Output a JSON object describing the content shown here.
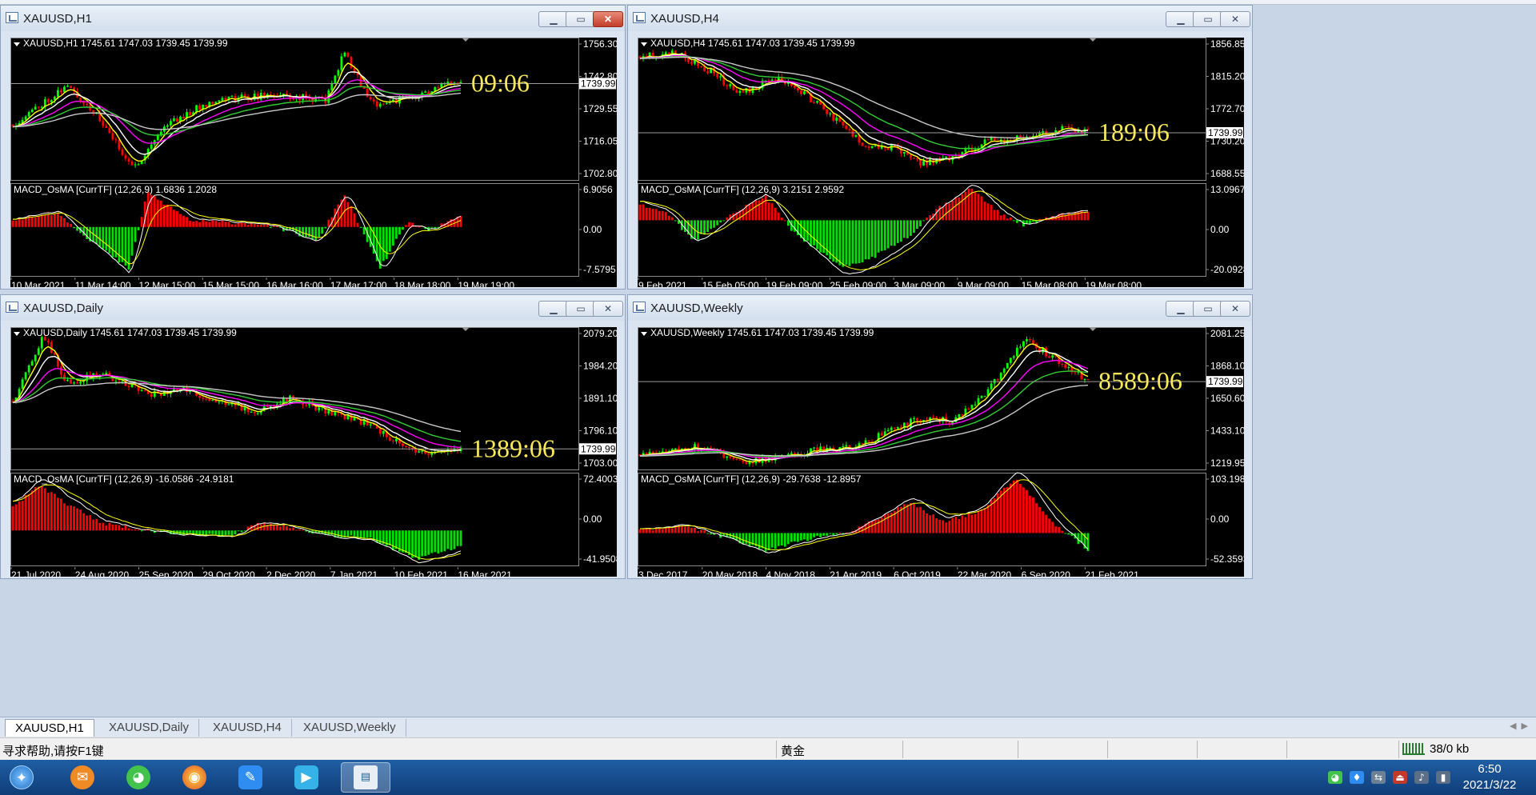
{
  "top_bar": {
    "label": ""
  },
  "windows": [
    {
      "id": "h1",
      "title": "XAUUSD,H1",
      "info": "XAUUSD,H1  1745.61 1747.03 1739.45 1739.99",
      "price_ticks": [
        "1756.30",
        "1742.80",
        "1729.55",
        "1716.05",
        "1702.80"
      ],
      "price_range": [
        1698.0,
        1760.0
      ],
      "current_price": "1739.99",
      "current_price_value": 1739.99,
      "countdown": "09:06",
      "macd_label": "MACD_OsMA [CurrTF] (12,26,9) 1.6836 1.2028",
      "macd_ticks": [
        "6.9056",
        "0.00",
        "-7.5795"
      ],
      "macd_range": [
        -8.5,
        7.6
      ],
      "time_ticks": [
        "10 Mar 2021",
        "11 Mar 14:00",
        "12 Mar 15:00",
        "15 Mar 15:00",
        "16 Mar 16:00",
        "17 Mar 17:00",
        "18 Mar 18:00",
        "19 Mar 19:00"
      ],
      "close_active": true,
      "seed": 11,
      "price_path": [
        [
          0,
          1722
        ],
        [
          0.12,
          1739
        ],
        [
          0.18,
          1728
        ],
        [
          0.27,
          1703
        ],
        [
          0.34,
          1722
        ],
        [
          0.45,
          1733
        ],
        [
          0.58,
          1735
        ],
        [
          0.7,
          1733
        ],
        [
          0.74,
          1754
        ],
        [
          0.8,
          1731
        ],
        [
          0.9,
          1734
        ],
        [
          1.0,
          1742
        ]
      ],
      "macd_path": [
        [
          0,
          1.2
        ],
        [
          0.1,
          2.5
        ],
        [
          0.16,
          -1.5
        ],
        [
          0.26,
          -7.3
        ],
        [
          0.3,
          6.0
        ],
        [
          0.4,
          1.0
        ],
        [
          0.55,
          0.6
        ],
        [
          0.62,
          -0.8
        ],
        [
          0.68,
          -2.5
        ],
        [
          0.74,
          5.8
        ],
        [
          0.82,
          -7.2
        ],
        [
          0.88,
          0.8
        ],
        [
          0.93,
          -0.5
        ],
        [
          1.0,
          1.7
        ]
      ]
    },
    {
      "id": "h4",
      "title": "XAUUSD,H4",
      "info": "XAUUSD,H4  1745.61 1747.03 1739.45 1739.99",
      "price_ticks": [
        "1856.85",
        "1815.20",
        "1772.70",
        "1730.20",
        "1688.55"
      ],
      "price_range": [
        1678.0,
        1865.0
      ],
      "current_price": "1739.99",
      "current_price_value": 1739.99,
      "countdown": "189:06",
      "macd_label": "MACD_OsMA [CurrTF] (12,26,9) 3.2151 2.9592",
      "macd_ticks": [
        "13.0967",
        "0.00",
        "-20.0928"
      ],
      "macd_range": [
        -21.0,
        14.0
      ],
      "time_ticks": [
        "9 Feb 2021",
        "15 Feb 05:00",
        "19 Feb 09:00",
        "25 Feb 09:00",
        "3 Mar 09:00",
        "9 Mar 09:00",
        "15 Mar 08:00",
        "19 Mar 08:00"
      ],
      "close_active": false,
      "seed": 23,
      "price_path": [
        [
          0,
          1840
        ],
        [
          0.08,
          1845
        ],
        [
          0.16,
          1820
        ],
        [
          0.22,
          1790
        ],
        [
          0.3,
          1812
        ],
        [
          0.36,
          1795
        ],
        [
          0.42,
          1765
        ],
        [
          0.5,
          1725
        ],
        [
          0.56,
          1720
        ],
        [
          0.63,
          1700
        ],
        [
          0.7,
          1708
        ],
        [
          0.78,
          1730
        ],
        [
          0.88,
          1735
        ],
        [
          0.94,
          1748
        ],
        [
          1.0,
          1742
        ]
      ],
      "macd_path": [
        [
          0,
          6
        ],
        [
          0.06,
          3
        ],
        [
          0.12,
          -8
        ],
        [
          0.2,
          2
        ],
        [
          0.28,
          9
        ],
        [
          0.34,
          -4
        ],
        [
          0.45,
          -18
        ],
        [
          0.52,
          -14
        ],
        [
          0.6,
          -6
        ],
        [
          0.66,
          4
        ],
        [
          0.74,
          12
        ],
        [
          0.8,
          3
        ],
        [
          0.86,
          -2
        ],
        [
          0.93,
          2
        ],
        [
          1.0,
          3
        ]
      ]
    },
    {
      "id": "daily",
      "title": "XAUUSD,Daily",
      "info": "XAUUSD,Daily  1745.61 1747.03 1739.45 1739.99",
      "price_ticks": [
        "2079.20",
        "1984.20",
        "1891.10",
        "1796.10",
        "1703.00"
      ],
      "price_range": [
        1680.0,
        2095.0
      ],
      "current_price": "1739.99",
      "current_price_value": 1739.99,
      "countdown": "1389:06",
      "macd_label": "MACD_OsMA [CurrTF] (12,26,9) -16.0586 -24.9181",
      "macd_ticks": [
        "72.4003",
        "0.00",
        "-41.9508"
      ],
      "macd_range": [
        -46.0,
        76.0
      ],
      "time_ticks": [
        "21 Jul 2020",
        "24 Aug 2020",
        "25 Sep 2020",
        "29 Oct 2020",
        "2 Dec 2020",
        "7 Jan 2021",
        "10 Feb 2021",
        "16 Mar 2021"
      ],
      "close_active": false,
      "seed": 37,
      "price_path": [
        [
          0,
          1880
        ],
        [
          0.07,
          2070
        ],
        [
          0.12,
          1930
        ],
        [
          0.2,
          1960
        ],
        [
          0.3,
          1900
        ],
        [
          0.38,
          1910
        ],
        [
          0.46,
          1880
        ],
        [
          0.54,
          1845
        ],
        [
          0.62,
          1890
        ],
        [
          0.7,
          1850
        ],
        [
          0.8,
          1810
        ],
        [
          0.9,
          1725
        ],
        [
          1.0,
          1740
        ]
      ],
      "macd_path": [
        [
          0,
          30
        ],
        [
          0.06,
          60
        ],
        [
          0.12,
          35
        ],
        [
          0.2,
          10
        ],
        [
          0.3,
          0
        ],
        [
          0.4,
          -5
        ],
        [
          0.48,
          -8
        ],
        [
          0.55,
          10
        ],
        [
          0.62,
          5
        ],
        [
          0.7,
          -6
        ],
        [
          0.8,
          -10
        ],
        [
          0.9,
          -38
        ],
        [
          1.0,
          -20
        ]
      ]
    },
    {
      "id": "weekly",
      "title": "XAUUSD,Weekly",
      "info": "XAUUSD,Weekly  1745.61 1747.03 1739.45 1739.99",
      "price_ticks": [
        "2081.25",
        "1868.10",
        "1650.60",
        "1433.10",
        "1219.95"
      ],
      "price_range": [
        1160.0,
        2100.0
      ],
      "current_price": "1739.99",
      "current_price_value": 1739.99,
      "countdown": "8589:06",
      "macd_label": "MACD_OsMA [CurrTF] (12,26,9) -29.7638 -12.8957",
      "macd_ticks": [
        "103.1985",
        "0.00",
        "-52.3593"
      ],
      "macd_range": [
        -58.0,
        108.0
      ],
      "time_ticks": [
        "3 Dec 2017",
        "20 May 2018",
        "4 Nov 2018",
        "21 Apr 2019",
        "6 Oct 2019",
        "22 Mar 2020",
        "6 Sep 2020",
        "21 Feb 2021"
      ],
      "close_active": false,
      "seed": 53,
      "price_path": [
        [
          0,
          1260
        ],
        [
          0.12,
          1320
        ],
        [
          0.22,
          1210
        ],
        [
          0.32,
          1240
        ],
        [
          0.4,
          1290
        ],
        [
          0.48,
          1300
        ],
        [
          0.56,
          1420
        ],
        [
          0.63,
          1500
        ],
        [
          0.7,
          1480
        ],
        [
          0.78,
          1690
        ],
        [
          0.86,
          2020
        ],
        [
          0.92,
          1900
        ],
        [
          1.0,
          1740
        ]
      ],
      "macd_path": [
        [
          0,
          5
        ],
        [
          0.1,
          12
        ],
        [
          0.2,
          -10
        ],
        [
          0.28,
          -30
        ],
        [
          0.38,
          -10
        ],
        [
          0.46,
          0
        ],
        [
          0.54,
          30
        ],
        [
          0.6,
          55
        ],
        [
          0.68,
          20
        ],
        [
          0.76,
          40
        ],
        [
          0.84,
          100
        ],
        [
          0.92,
          20
        ],
        [
          1.0,
          -30
        ]
      ]
    }
  ],
  "tabs": [
    "XAUUSD,H1",
    "XAUUSD,Daily",
    "XAUUSD,H4",
    "XAUUSD,Weekly"
  ],
  "status": {
    "help": "寻求帮助,请按F1键",
    "profile": "黄金",
    "traffic": "38/0 kb"
  },
  "clock": {
    "time": "6:50",
    "date": "2021/3/22"
  },
  "colors": {
    "chart_bg": "#000000",
    "bull_candle": "#00ff00",
    "bear_candle": "#ff0000",
    "ma_fast": "#ffff00",
    "ma_white": "#ffffff",
    "ma_magenta": "#ff00ff",
    "ma_green": "#32cd32",
    "ma_grey": "#c8c8c8",
    "hist_pos": "#ff0000",
    "hist_neg": "#00e000",
    "countdown": "#f7e85b"
  }
}
